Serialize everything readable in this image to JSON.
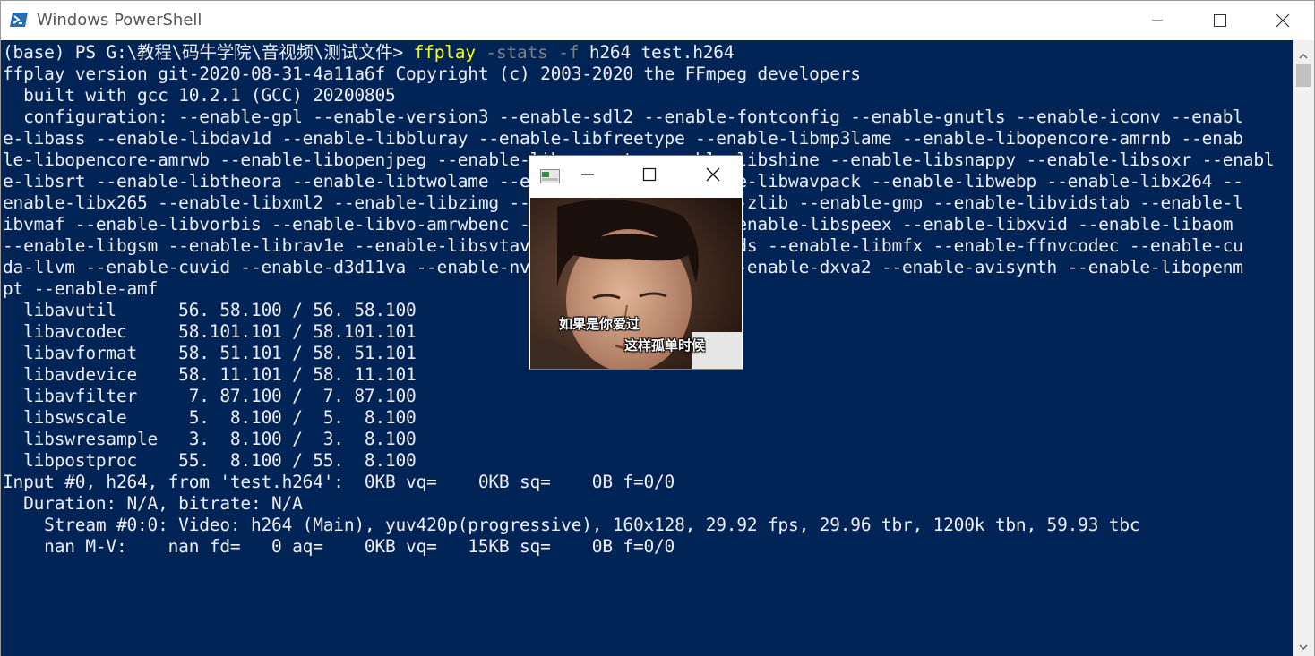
{
  "window": {
    "title": "Windows PowerShell"
  },
  "prompt": {
    "text": "(base) PS G:\\教程\\码牛学院\\音视频\\测试文件> ",
    "command": "ffplay",
    "params": " -stats -f",
    "args": " h264 test.h264"
  },
  "output_lines": [
    "ffplay version git-2020-08-31-4a11a6f Copyright (c) 2003-2020 the FFmpeg developers",
    "  built with gcc 10.2.1 (GCC) 20200805",
    "  configuration: --enable-gpl --enable-version3 --enable-sdl2 --enable-fontconfig --enable-gnutls --enable-iconv --enabl",
    "e-libass --enable-libdav1d --enable-libbluray --enable-libfreetype --enable-libmp3lame --enable-libopencore-amrnb --enab",
    "le-libopencore-amrwb --enable-libopenjpeg --enable-libopenmpt --enable-libshine --enable-libsnappy --enable-libsoxr --enabl",
    "e-libsrt --enable-libtheora --enable-libtwolame --enable-libvpx --enable-libwavpack --enable-libwebp --enable-libx264 --",
    "enable-libx265 --enable-libxml2 --enable-libzimg --enable-lzma --enable-zlib --enable-gmp --enable-libvidstab --enable-l",
    "ibvmaf --enable-libvorbis --enable-libvo-amrwbenc --enable-libmysofa --enable-libspeex --enable-libxvid --enable-libaom ",
    "--enable-libgsm --enable-librav1e --enable-libsvtav1 --disable-w32threads --enable-libmfx --enable-ffnvcodec --enable-cu",
    "da-llvm --enable-cuvid --enable-d3d11va --enable-nvenc --enable-nvdec --enable-dxva2 --enable-avisynth --enable-libopenm",
    "pt --enable-amf",
    "  libavutil      56. 58.100 / 56. 58.100",
    "  libavcodec     58.101.101 / 58.101.101",
    "  libavformat    58. 51.101 / 58. 51.101",
    "  libavdevice    58. 11.101 / 58. 11.101",
    "  libavfilter     7. 87.100 /  7. 87.100",
    "  libswscale      5.  8.100 /  5.  8.100",
    "  libswresample   3.  8.100 /  3.  8.100",
    "  libpostproc    55.  8.100 / 55.  8.100",
    "Input #0, h264, from 'test.h264':  0KB vq=    0KB sq=    0B f=0/0",
    "  Duration: N/A, bitrate: N/A",
    "    Stream #0:0: Video: h264 (Main), yuv420p(progressive), 160x128, 29.92 fps, 29.96 tbr, 1200k tbn, 59.93 tbc",
    "    nan M-V:    nan fd=   0 aq=    0KB vq=   15KB sq=    0B f=0/0"
  ],
  "player": {
    "subtitle_1": "如果是你爱过",
    "subtitle_2": "这样孤单时候"
  },
  "icons": {
    "app": "powershell-icon",
    "minimize": "minimize-icon",
    "maximize": "maximize-icon",
    "close": "close-icon"
  }
}
